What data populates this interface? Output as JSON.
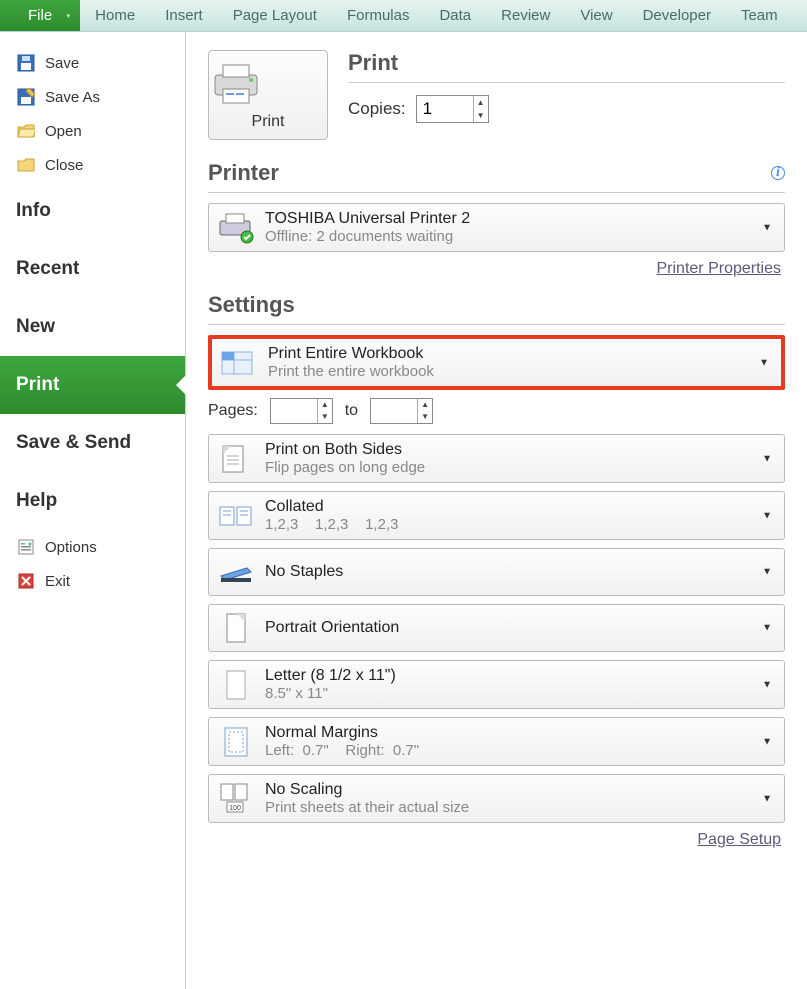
{
  "ribbon": {
    "file": "File",
    "tabs": [
      "Home",
      "Insert",
      "Page Layout",
      "Formulas",
      "Data",
      "Review",
      "View",
      "Developer",
      "Team"
    ]
  },
  "sidebar": {
    "icons": [
      {
        "label": "Save"
      },
      {
        "label": "Save As"
      },
      {
        "label": "Open"
      },
      {
        "label": "Close"
      }
    ],
    "big": [
      "Info",
      "Recent",
      "New",
      "Print",
      "Save & Send",
      "Help"
    ],
    "active": "Print",
    "footer": [
      {
        "label": "Options"
      },
      {
        "label": "Exit"
      }
    ]
  },
  "print": {
    "heading": "Print",
    "button_label": "Print",
    "copies_label": "Copies:",
    "copies_value": "1"
  },
  "printer": {
    "heading": "Printer",
    "name": "TOSHIBA Universal Printer 2",
    "status": "Offline: 2 documents waiting",
    "properties_link": "Printer Properties"
  },
  "settings": {
    "heading": "Settings",
    "what": {
      "title": "Print Entire Workbook",
      "sub": "Print the entire workbook"
    },
    "pages_label": "Pages:",
    "pages_to": "to",
    "pages_from_value": "",
    "pages_to_value": "",
    "sides": {
      "title": "Print on Both Sides",
      "sub": "Flip pages on long edge"
    },
    "collate": {
      "title": "Collated",
      "sub": "1,2,3    1,2,3    1,2,3"
    },
    "staples": {
      "title": "No Staples"
    },
    "orientation": {
      "title": "Portrait Orientation"
    },
    "paper": {
      "title": "Letter (8 1/2 x 11\")",
      "sub": "8.5\" x 11\""
    },
    "margins": {
      "title": "Normal Margins",
      "sub": "Left:  0.7\"    Right:  0.7\""
    },
    "scaling": {
      "title": "No Scaling",
      "sub": "Print sheets at their actual size"
    },
    "page_setup_link": "Page Setup"
  }
}
